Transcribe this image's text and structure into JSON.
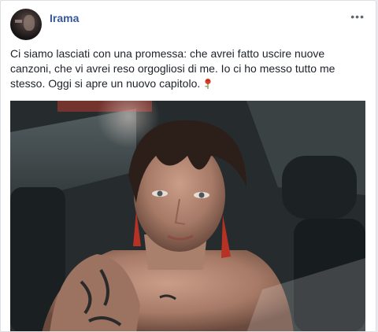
{
  "post": {
    "author": "Irama",
    "text": "Ci siamo lasciati con una promessa: che avrei fatto uscire nuove canzoni, che vi avrei reso orgogliosi di me. Io ci ho messo tutto me stesso. Oggi si apre un nuovo capitolo.",
    "more_label": "•••",
    "emoji": "rose-icon"
  },
  "colors": {
    "link": "#365899",
    "text": "#1d2129",
    "border": "#dddfe2"
  }
}
